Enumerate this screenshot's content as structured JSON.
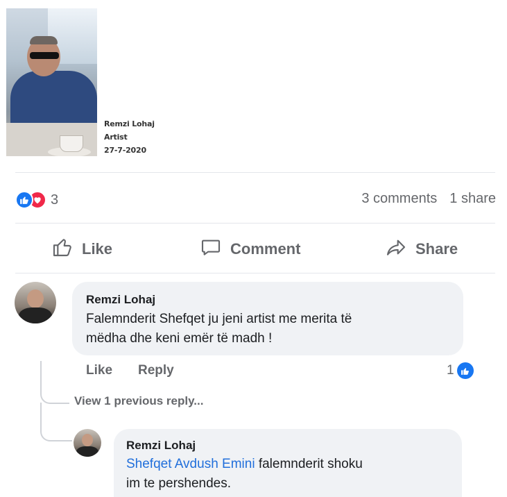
{
  "post": {
    "caption": {
      "name": "Remzi Lohaj",
      "role": "Artist",
      "date": "27-7-2020"
    }
  },
  "reactions": {
    "count": "3",
    "types": [
      "like",
      "love"
    ]
  },
  "stats": {
    "comments": "3 comments",
    "shares": "1 share"
  },
  "actions": {
    "like": "Like",
    "comment": "Comment",
    "share": "Share"
  },
  "comments": [
    {
      "author": "Remzi Lohaj",
      "text": "Falemnderit Shefqet ju jeni artist me merita të mëdha dhe keni emër të madh !",
      "line1": "Falemnderit Shefqet ju jeni artist me merita të",
      "line2": "mëdha dhe keni emër të madh !",
      "like_label": "Like",
      "reply_label": "Reply",
      "reaction_count": "1"
    }
  ],
  "view_previous": "View 1 previous reply...",
  "reply": {
    "author": "Remzi Lohaj",
    "mention": "Shefqet Avdush Emini",
    "text_rest": " falemnderit shoku",
    "line2": "im te pershendes."
  },
  "colors": {
    "accent": "#1877f2",
    "love": "#f02849",
    "muted": "#65676b",
    "bubble": "#f0f2f5",
    "mention": "#216fdb"
  }
}
